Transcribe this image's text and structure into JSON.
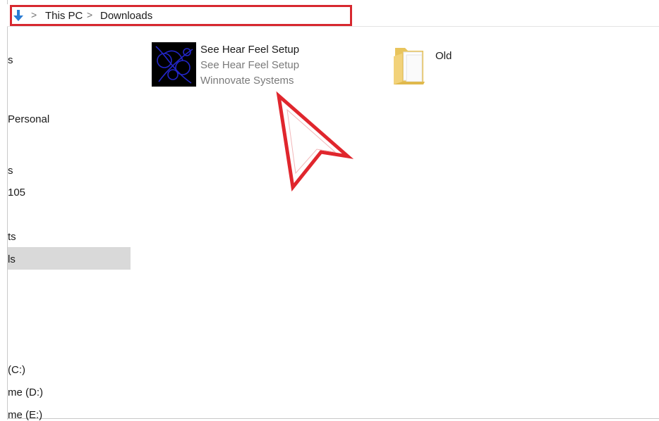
{
  "address_bar": {
    "crumbs": [
      "This PC",
      "Downloads"
    ],
    "separator": ">"
  },
  "sidebar": {
    "items": [
      {
        "label": "s"
      },
      {
        "label": "Personal"
      },
      {
        "label": "s"
      },
      {
        "label": "105"
      },
      {
        "label": "ts"
      },
      {
        "label": "ls",
        "selected": true
      },
      {
        "label": "(C:)"
      },
      {
        "label": "me (D:)"
      },
      {
        "label": "me (E:)"
      }
    ]
  },
  "files": [
    {
      "name": "See Hear Feel Setup",
      "description": "See Hear Feel Setup",
      "company": "Winnovate Systems",
      "icon": "application-icon"
    },
    {
      "name": "Old",
      "icon": "folder-icon"
    }
  ],
  "colors": {
    "highlight_border": "#d7282f",
    "annotation_arrow": "#e0262d",
    "selected_bg": "#d9d9d9",
    "secondary_text": "#7a7a7a",
    "nav_arrow": "#2b7cd3"
  }
}
